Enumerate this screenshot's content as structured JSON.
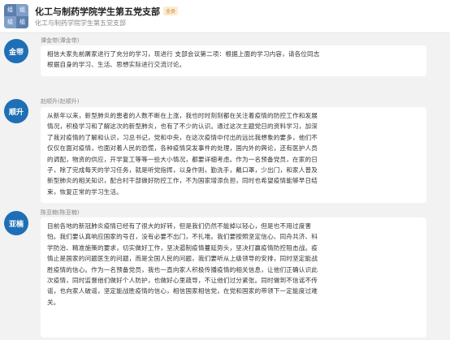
{
  "header": {
    "avatar_chars": [
      "组",
      "组",
      "组",
      "组"
    ],
    "title": "化工与制药学院学生第五党支部",
    "badge": "全员",
    "subtitle": "化工与制药学院学生第五党支部"
  },
  "messages": [
    {
      "avatar_label": "金带",
      "sender": "谭金带(谭金带)",
      "text": "相信大家先前屠家进行了充分的学习，现进行 支部会议第二项：根据上面的学习内容，请各位同志\n根据自身的学习、生活、思想实际进行交流讨论。"
    },
    {
      "avatar_label": "顺升",
      "sender": "赵顺升(赵顺升)",
      "text": "从新年以来，新型肺炎的患者的人数不断在上涨，我也时时刻刻都在关注着疫情的防控工作和发展\n情况，积极学习和了解这次的新型肺炎，也有了不少的认识。通过这次主题党日的资料学习，加深\n了我对疫情的了解和认识，习总书记，党和中央，在这次疫情中付出的远比我想象的要多，他们不\n仅仅在面对疫情，也面对着人民的恐慌，各种疫情突发事件的处理，国内外的舆论，还有医护人员\n的调配，物资的供应，开学复工等等一些大小情况，都要详细考虑。作为一名预备党员，在家的日\n子，除了完成每天的学习任务，就是听党指挥，以身作则，勤洗手，戴口罩，少出门，和家人普及\n新型肺炎的相关知识，配合村干部做好防控工作，不为国家增添负担，同时也希望疫情能够早日结\n束，恢复正常的学习生活。"
    },
    {
      "avatar_label": "亚楠",
      "sender": "陈亚楠(陈亚楠)",
      "text": "目前各地的新冠肺炎疫情已经有了很大的好转，但是我们仍然不能掉以轻心，但是也不用过度害\n怕。我们要认真响应国家的号召，没有必要不出门，不扎堆。我们要按照坚定信心、同舟共济、科\n学防治、精准施策的要求，切实做好工作，坚决遏制疫情蔓延势头，坚决打赢疫情防控阻击战。疫\n情止是国家的问题医生的问题，而是全国人民的问题，我们要听从上级领导的安排，同时坚定能战\n胜疫情的信心。作为一名预备党员，我也一直向家人积极传播疫情的相关信息，让他们正确认识此\n次疫情，同时监督他们做好个人防护，也做好心里疏导，不让他们过分紧张。同时做到不信谣不传\n谣，也向家人破谣，坚定能战胜疫情的信心，相信国家相信党，在党和国家的带领下一定能度过难\n关。"
    }
  ]
}
